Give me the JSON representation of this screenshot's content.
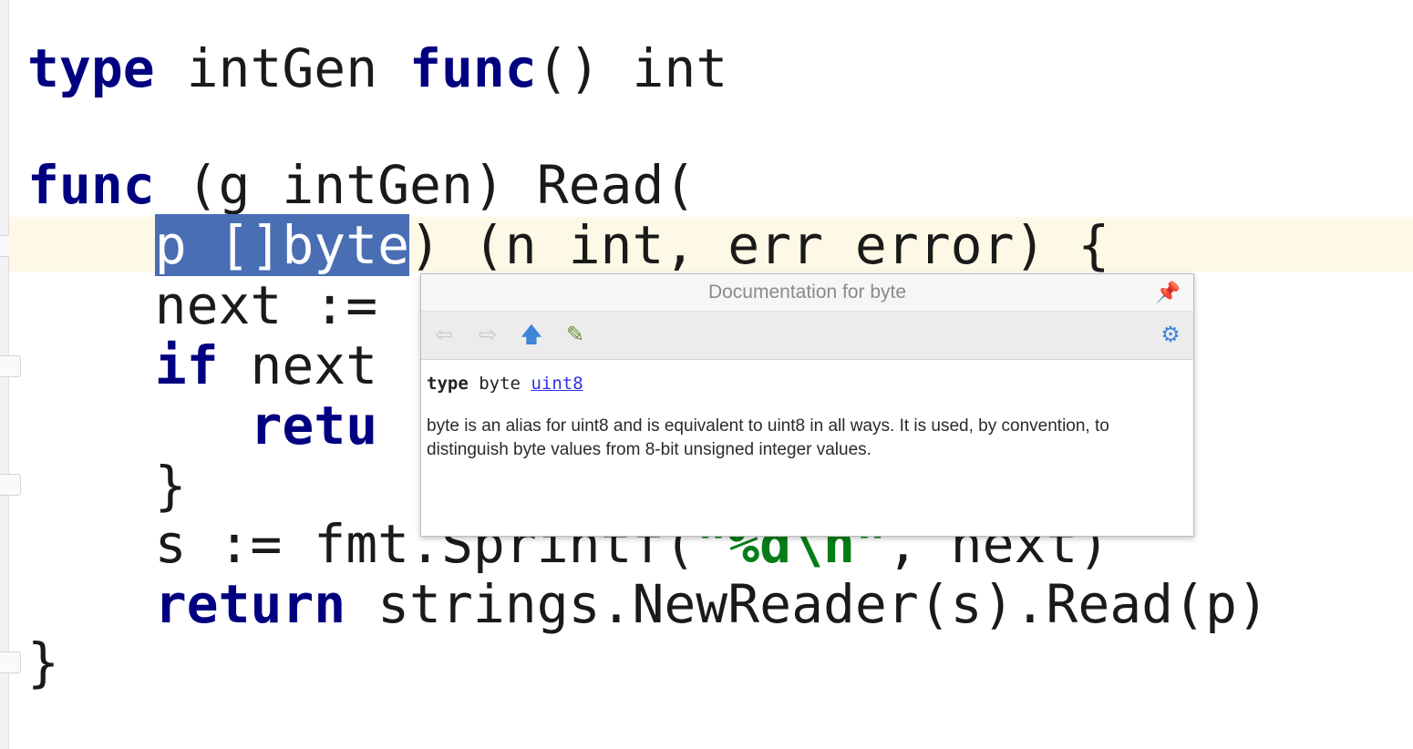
{
  "editor": {
    "lines": [
      [
        {
          "t": "type",
          "k": "kw"
        },
        {
          "t": " intGen "
        },
        {
          "t": "func",
          "k": "kw"
        },
        {
          "t": "() int"
        }
      ],
      [],
      [
        {
          "t": "func",
          "k": "kw"
        },
        {
          "t": " (g intGen) Read("
        }
      ],
      [
        {
          "t": "    "
        },
        {
          "t": "p []byte",
          "k": "sel"
        },
        {
          "t": ") (n int, err error) {"
        }
      ],
      [
        {
          "t": "    next := "
        }
      ],
      [
        {
          "t": "    "
        },
        {
          "t": "if",
          "k": "kw"
        },
        {
          "t": " next "
        }
      ],
      [
        {
          "t": "       "
        },
        {
          "t": "retu",
          "k": "kw"
        }
      ],
      [
        {
          "t": "    }"
        }
      ],
      [
        {
          "t": "    s := fmt.Sprintf("
        },
        {
          "t": "\"%d\\n\"",
          "k": "str"
        },
        {
          "t": ", next)"
        }
      ],
      [
        {
          "t": "    "
        },
        {
          "t": "return",
          "k": "kw"
        },
        {
          "t": " strings.NewReader(s).Read(p)"
        }
      ],
      [
        {
          "t": "}"
        }
      ]
    ]
  },
  "popup": {
    "title": "Documentation for byte",
    "pin_icon": "pin-icon",
    "toolbar": {
      "back_icon": "⇦",
      "forward_icon": "⇨",
      "up_icon": "🡅",
      "edit_icon": "✎",
      "settings_icon": "⚙"
    },
    "signature": {
      "keyword": "type",
      "name": "byte",
      "link": "uint8"
    },
    "description": "byte is an alias for uint8 and is equivalent to uint8 in all ways. It is used, by convention, to distinguish byte values from 8-bit unsigned integer values."
  },
  "colors": {
    "keyword": "#000080",
    "string": "#067d17",
    "selection": "#4a6eb4",
    "caret_line": "#fdf9e6"
  }
}
